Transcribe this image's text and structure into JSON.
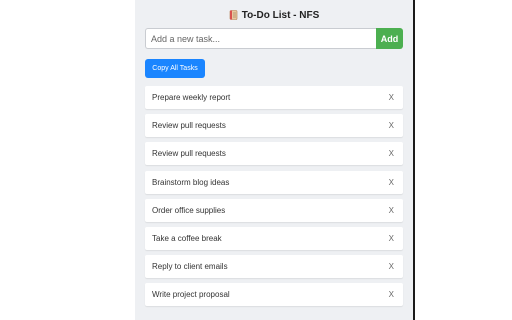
{
  "header": {
    "title": "To-Do List - NFS",
    "icon": "notebook-icon"
  },
  "input": {
    "placeholder": "Add a new task...",
    "value": ""
  },
  "buttons": {
    "add_label": "Add",
    "copy_label": "Copy All Tasks"
  },
  "tasks": [
    {
      "text": "Prepare weekly report",
      "delete_label": "X"
    },
    {
      "text": "Review pull requests",
      "delete_label": "X"
    },
    {
      "text": "Review pull requests",
      "delete_label": "X"
    },
    {
      "text": "Brainstorm blog ideas",
      "delete_label": "X"
    },
    {
      "text": "Order office supplies",
      "delete_label": "X"
    },
    {
      "text": "Take a coffee break",
      "delete_label": "X"
    },
    {
      "text": "Reply to client emails",
      "delete_label": "X"
    },
    {
      "text": "Write project proposal",
      "delete_label": "X"
    }
  ],
  "colors": {
    "panel_bg": "#eef0f3",
    "add_button": "#4caf50",
    "copy_button": "#1a85ff"
  }
}
